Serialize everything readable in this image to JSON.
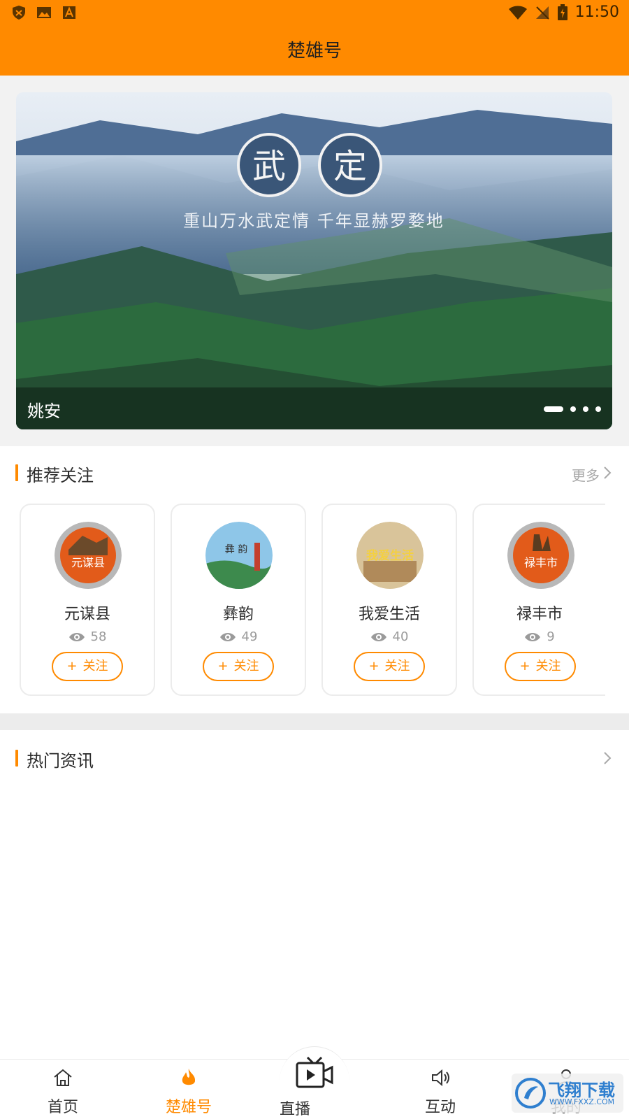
{
  "status_bar": {
    "time": "11:50"
  },
  "header": {
    "title": "楚雄号"
  },
  "banner": {
    "caption": "姚安",
    "seal_1": "武",
    "seal_2": "定",
    "slogan": "重山万水武定情 千年显赫罗婺地",
    "slides_total": 4,
    "active_slide": 1
  },
  "recommend": {
    "title": "推荐关注",
    "more": "更多",
    "follow_label": "关注",
    "items": [
      {
        "name": "元谋县",
        "views": "58",
        "avatar_text": "元谋县"
      },
      {
        "name": "彝韵",
        "views": "49",
        "avatar_text": "彝 韵"
      },
      {
        "name": "我爱生活",
        "views": "40",
        "avatar_text": "我爱生活"
      },
      {
        "name": "禄丰市",
        "views": "9",
        "avatar_text": "禄丰市"
      }
    ]
  },
  "hot_news": {
    "title": "热门资讯"
  },
  "nav": {
    "items": [
      {
        "label": "首页",
        "icon": "home-icon"
      },
      {
        "label": "楚雄号",
        "icon": "flame-icon",
        "active": true
      },
      {
        "label": "直播",
        "icon": "tv-play-icon"
      },
      {
        "label": "互动",
        "icon": "speaker-icon"
      },
      {
        "label": "我的",
        "icon": "person-icon"
      }
    ]
  },
  "watermark": {
    "text": "飞翔下载",
    "sub": "WWW.FXXZ.COM"
  },
  "colors": {
    "accent": "#ff8a00",
    "text": "#2b2b2b",
    "muted": "#9a9a9a"
  }
}
